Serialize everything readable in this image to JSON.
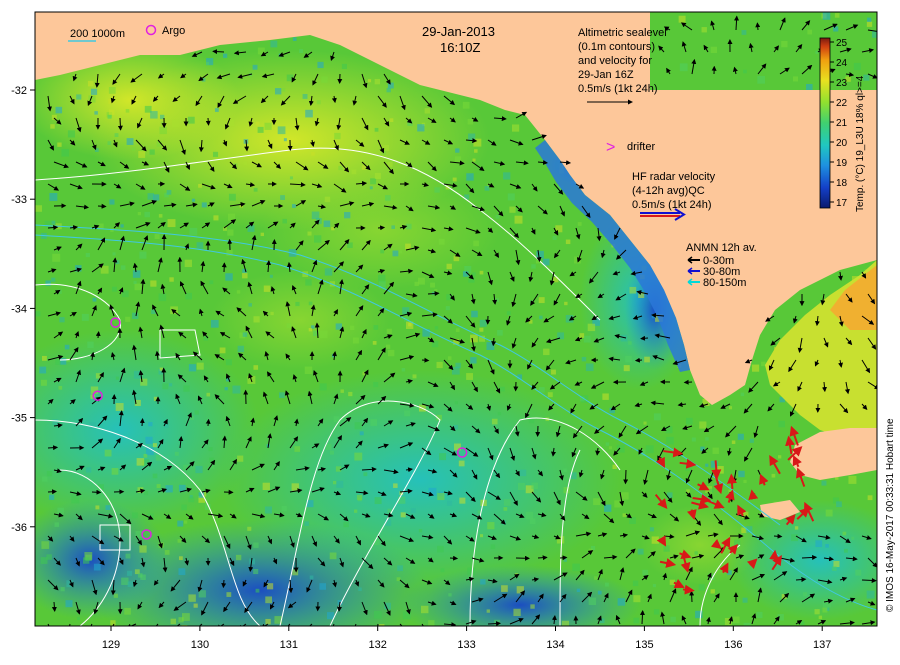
{
  "title": {
    "date": "29-Jan-2013",
    "time": "16:10Z"
  },
  "legend": {
    "scale_label": "200  1000m",
    "argo_label": "Argo",
    "altimetric": [
      "Altimetric sealevel",
      "(0.1m contours)",
      "and velocity for",
      "29-Jan 16Z",
      "0.5m/s (1kt 24h)"
    ],
    "drifter_label": "drifter",
    "hf_radar": [
      "HF radar velocity",
      "(4-12h avg)QC",
      "0.5m/s (1kt 24h)"
    ],
    "anmn_title": "ANMN 12h av.",
    "anmn_items": [
      {
        "label": "0-30m",
        "color": "#000000"
      },
      {
        "label": "30-80m",
        "color": "#1010d0"
      },
      {
        "label": "80-150m",
        "color": "#00d8d8"
      }
    ]
  },
  "colorbar": {
    "ticks": [
      "25",
      "24",
      "23",
      "22",
      "21",
      "20",
      "19",
      "18",
      "17"
    ],
    "label": "Temp. (°C) 19_L3U 18% ql>=4",
    "colors": [
      "#0a1a6e",
      "#1440c8",
      "#1e90e0",
      "#20c8c0",
      "#40d070",
      "#90e030",
      "#e8e020",
      "#f0a010",
      "#d04010",
      "#7a1a10"
    ]
  },
  "axes": {
    "x_ticks": [
      "129",
      "130",
      "131",
      "132",
      "133",
      "134",
      "135",
      "136",
      "137"
    ],
    "y_ticks": [
      "-32",
      "-33",
      "-34",
      "-35",
      "-36"
    ]
  },
  "credit": "© IMOS 16-May-2017 00:33:31 Hobart time",
  "argo_floats": [
    {
      "lon": 129.05,
      "lat": -34.13
    },
    {
      "lon": 128.85,
      "lat": -34.8
    },
    {
      "lon": 132.95,
      "lat": -35.32
    },
    {
      "lon": 129.4,
      "lat": -36.07
    }
  ],
  "colors": {
    "land": "#fdc79a",
    "ocean_base": "#58c838",
    "argo": "#e020e0",
    "hf_radar": "#d81818",
    "isobath_200": "#40c8e0",
    "contour": "#ffffff"
  }
}
